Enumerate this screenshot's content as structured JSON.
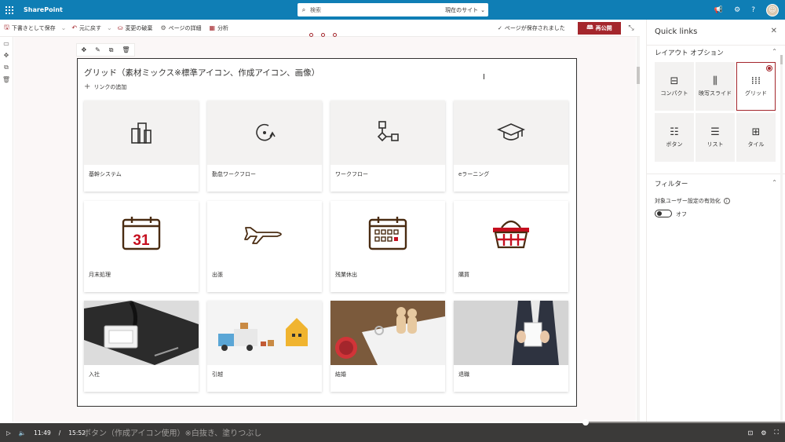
{
  "suite": {
    "brand": "SharePoint",
    "search_placeholder": "検索",
    "search_scope": "現在のサイト",
    "colors": {
      "suite_bar": "#0f7eb5",
      "accent": "#a4262c"
    }
  },
  "commands": {
    "save_draft": "下書きとして保存",
    "undo": "元に戻す",
    "discard": "変更の破棄",
    "page_details": "ページの詳細",
    "analytics": "分析",
    "saved_status": "ページが保存されました",
    "republish": "再公開"
  },
  "webpart": {
    "title": "グリッド（素材ミックス※標準アイコン、作成アイコン、画像）",
    "add_link": "リンクの追加"
  },
  "links": [
    {
      "label": "基幹システム",
      "icon": "buildings-icon"
    },
    {
      "label": "勤怠ワークフロー",
      "icon": "cycle-arrow-icon"
    },
    {
      "label": "ワークフロー",
      "icon": "workflow-icon"
    },
    {
      "label": "eラーニング",
      "icon": "graduation-cap-icon"
    },
    {
      "label": "月末処理",
      "icon": "calendar-31-icon",
      "calendar_number": "31"
    },
    {
      "label": "出張",
      "icon": "airplane-icon"
    },
    {
      "label": "残業休出",
      "icon": "calendar-grid-icon"
    },
    {
      "label": "購買",
      "icon": "shopping-basket-icon"
    },
    {
      "label": "入社",
      "icon": "id-card-lanyard-photo"
    },
    {
      "label": "引越",
      "icon": "moving-truck-photo"
    },
    {
      "label": "結婚",
      "icon": "wedding-documents-photo"
    },
    {
      "label": "退職",
      "icon": "resignation-letter-photo"
    }
  ],
  "video": {
    "current_time": "11:49",
    "separator": "/",
    "duration": "15:52",
    "progress": 0.746,
    "caption": "ボタン（作成アイコン使用）※白抜き、塗りつぶし"
  },
  "pane": {
    "title": "Quick links",
    "layout_section": "レイアウト オプション",
    "layouts": [
      {
        "label": "コンパクト",
        "icon": "compact-layout-icon",
        "selected": false
      },
      {
        "label": "映写スライド",
        "icon": "filmstrip-layout-icon",
        "selected": false
      },
      {
        "label": "グリッド",
        "icon": "grid-layout-icon",
        "selected": true
      },
      {
        "label": "ボタン",
        "icon": "button-layout-icon",
        "selected": false
      },
      {
        "label": "リスト",
        "icon": "list-layout-icon",
        "selected": false
      },
      {
        "label": "タイル",
        "icon": "tile-layout-icon",
        "selected": false
      }
    ],
    "filter_section": "フィルター",
    "audience_label": "対象ユーザー設定の有効化",
    "audience_toggle": "オフ"
  }
}
